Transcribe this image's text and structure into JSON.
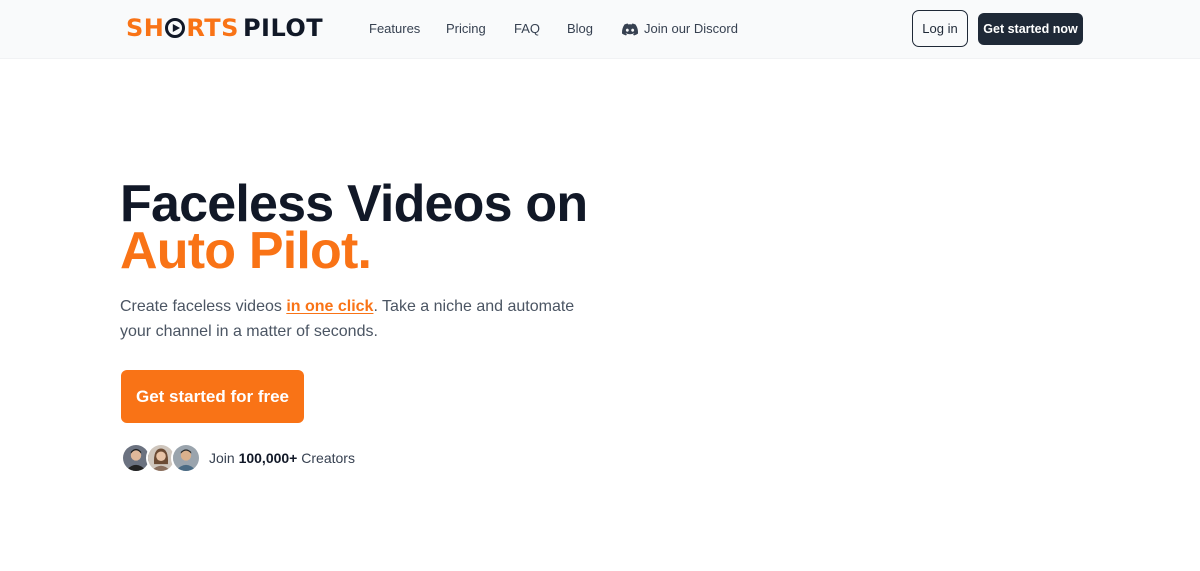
{
  "brand": {
    "name_part1": "SHORTS",
    "name_part2": "PILOT",
    "accent_color": "#f97316",
    "dark_color": "#111827"
  },
  "nav": {
    "items": [
      {
        "label": "Features"
      },
      {
        "label": "Pricing"
      },
      {
        "label": "FAQ"
      },
      {
        "label": "Blog"
      }
    ],
    "discord_label": "Join our Discord",
    "discord_icon": "discord-icon",
    "login_label": "Log in",
    "get_started_label": "Get started now"
  },
  "hero": {
    "headline_line1": "Faceless Videos on",
    "headline_line2": "Auto Pilot.",
    "sub_before": "Create faceless videos ",
    "sub_link": "in one click",
    "sub_after": ". Take a niche and automate your channel in a matter of seconds.",
    "cta_label": "Get started for free"
  },
  "social_proof": {
    "prefix": "Join ",
    "count": "100,000+",
    "suffix": " Creators",
    "avatar_count": 3
  }
}
